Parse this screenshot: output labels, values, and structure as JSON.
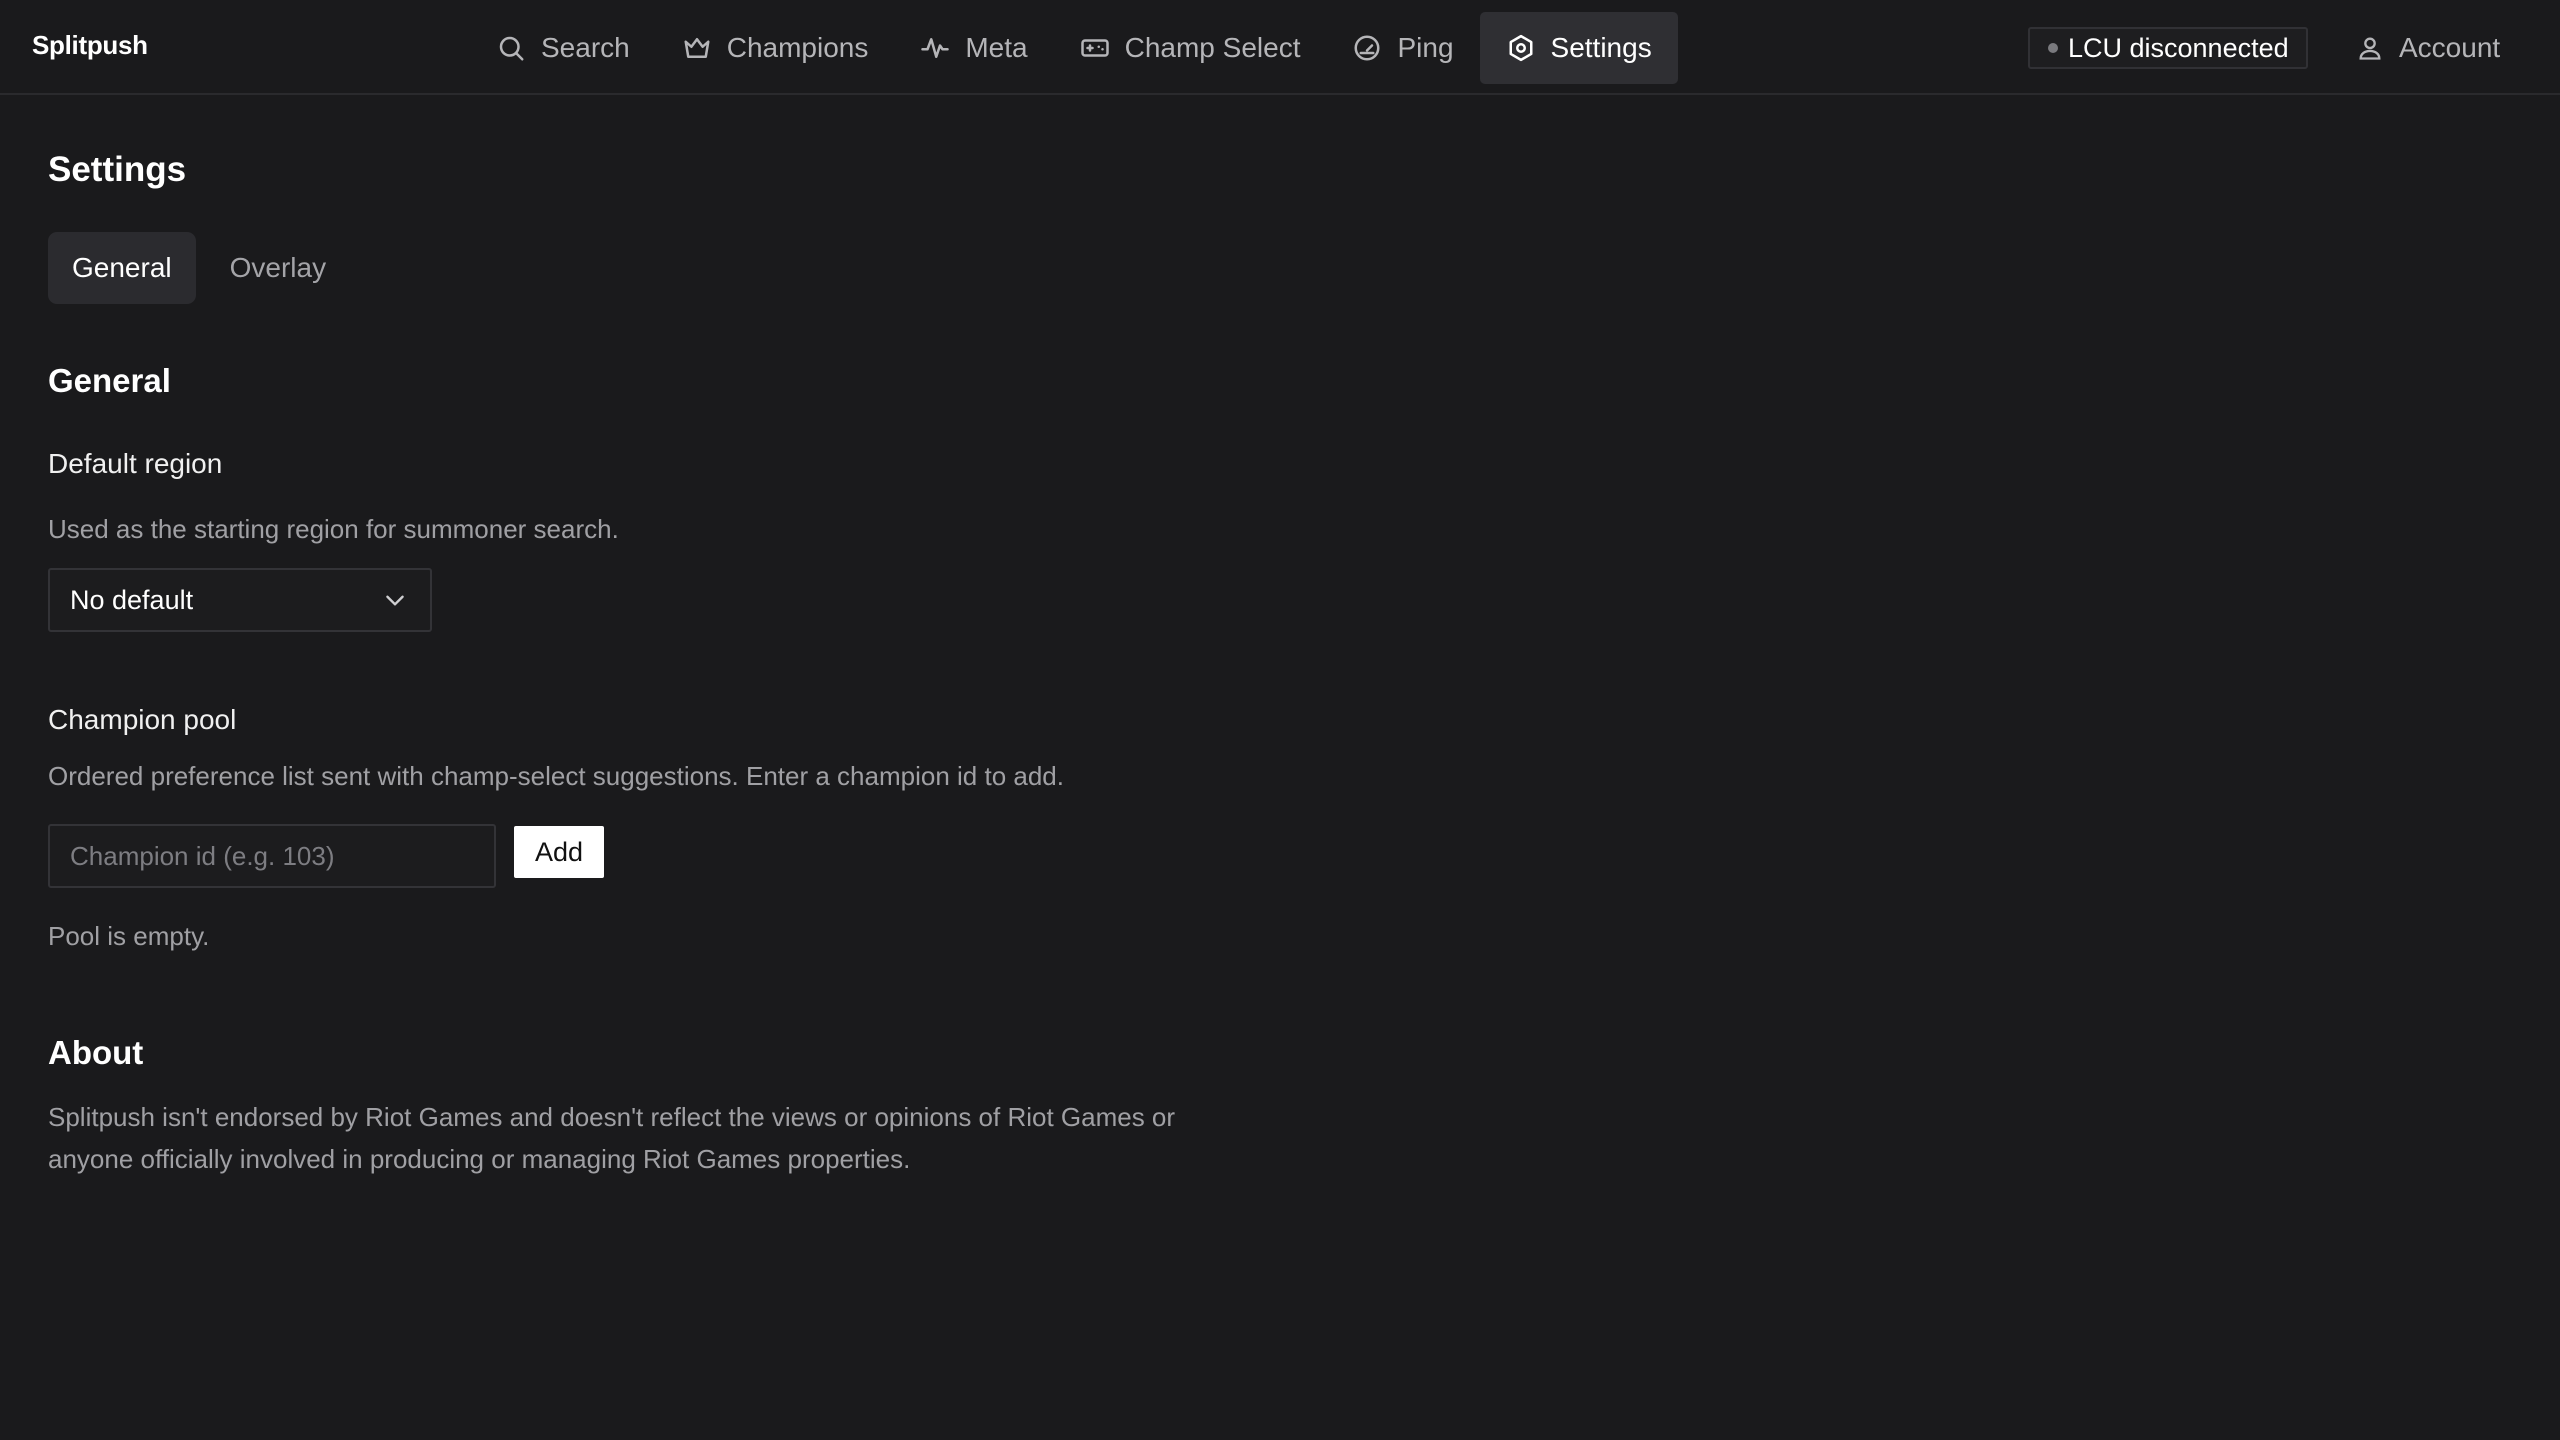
{
  "brand": "Splitpush",
  "nav": {
    "items": [
      {
        "label": "Search",
        "icon": "search-icon"
      },
      {
        "label": "Champions",
        "icon": "crown-icon"
      },
      {
        "label": "Meta",
        "icon": "activity-icon"
      },
      {
        "label": "Champ Select",
        "icon": "gamepad-icon"
      },
      {
        "label": "Ping",
        "icon": "gauge-icon"
      },
      {
        "label": "Settings",
        "icon": "settings-icon",
        "active": true
      }
    ]
  },
  "status": {
    "label": "LCU disconnected",
    "dot_color": "#7a7a7e"
  },
  "account": {
    "label": "Account",
    "icon": "user-icon"
  },
  "page": {
    "title": "Settings",
    "tabs": [
      {
        "label": "General",
        "active": true
      },
      {
        "label": "Overlay",
        "active": false
      }
    ]
  },
  "general": {
    "section_title": "General",
    "default_region": {
      "label": "Default region",
      "help": "Used as the starting region for summoner search.",
      "selected": "No default"
    },
    "champion_pool": {
      "label": "Champion pool",
      "help": "Ordered preference list sent with champ-select suggestions. Enter a champion id to add.",
      "input_placeholder": "Champion id (e.g. 103)",
      "input_value": "",
      "add_label": "Add",
      "empty_text": "Pool is empty."
    }
  },
  "about": {
    "title": "About",
    "text": "Splitpush isn't endorsed by Riot Games and doesn't reflect the views or opinions of Riot Games or anyone officially involved in producing or managing Riot Games properties."
  },
  "colors": {
    "background": "#1a1a1c",
    "active_nav": "#2f2f33",
    "button": "#ffffff"
  }
}
